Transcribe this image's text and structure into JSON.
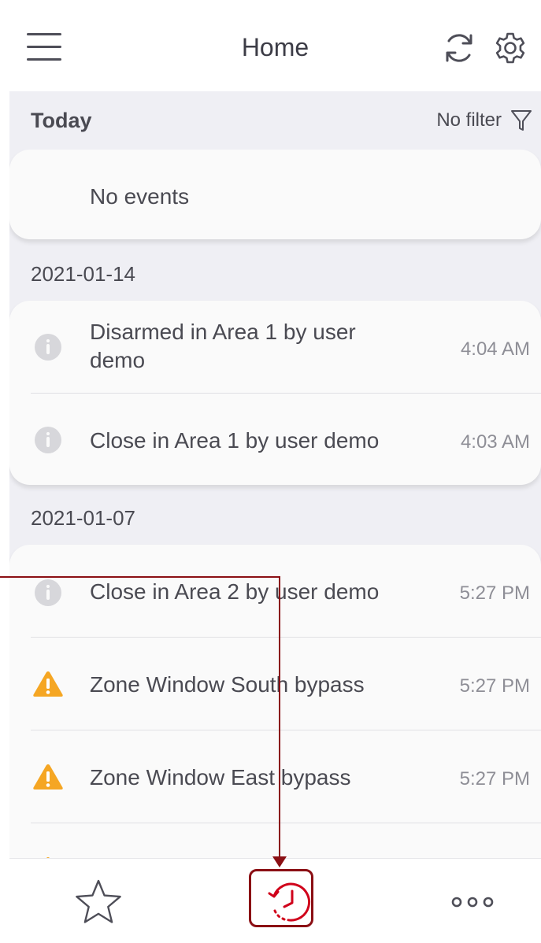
{
  "header": {
    "title": "Home",
    "menu_icon": "hamburger-menu-icon",
    "sync_icon": "sync-icon",
    "settings_icon": "gear-icon"
  },
  "today": {
    "label": "Today",
    "filter_label": "No filter",
    "filter_icon": "filter-funnel-icon",
    "empty_text": "No events"
  },
  "groups": [
    {
      "date": "2021-01-14",
      "events": [
        {
          "icon": "info-icon",
          "text": "Disarmed in Area 1 by user demo",
          "time": "4:04 AM"
        },
        {
          "icon": "info-icon",
          "text": "Close in Area 1 by user demo",
          "time": "4:03 AM"
        }
      ]
    },
    {
      "date": "2021-01-07",
      "events": [
        {
          "icon": "info-icon",
          "text": "Close in Area 2 by user demo",
          "time": "5:27 PM"
        },
        {
          "icon": "warning-icon",
          "text": "Zone Window South bypass",
          "time": "5:27 PM"
        },
        {
          "icon": "warning-icon",
          "text": "Zone Window East bypass",
          "time": "5:27 PM"
        }
      ]
    }
  ],
  "tabbar": {
    "tabs": [
      {
        "icon": "star-icon",
        "active": false
      },
      {
        "icon": "history-clock-icon",
        "active": true
      },
      {
        "icon": "more-dots-icon",
        "active": false
      }
    ]
  },
  "colors": {
    "accent": "#d0021b",
    "warning": "#f5a623",
    "annotation": "#8b0f14",
    "icon_gray": "#4e4e58",
    "info_gray": "#d7d7db"
  }
}
